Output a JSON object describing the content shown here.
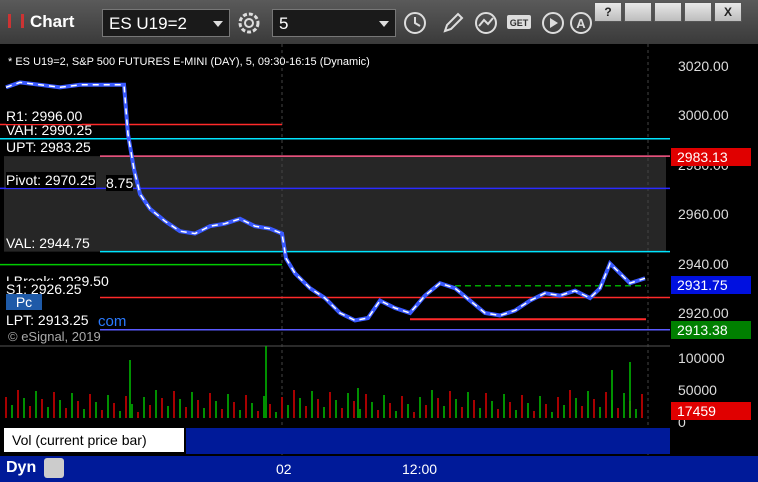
{
  "toolbar": {
    "title": "Chart",
    "symbol": "ES U19=2",
    "interval": "5",
    "icons": [
      "settings-icon",
      "clock-icon",
      "pencil-icon",
      "study-icon",
      "get-icon",
      "play-icon",
      "text-a-icon"
    ],
    "window_buttons": [
      "?",
      "",
      "",
      "X"
    ]
  },
  "chart": {
    "study_label": "* ES U19=2, S&P 500 FUTURES E-MINI (DAY), 5, 09:30-16:15 (Dynamic)",
    "levels": [
      {
        "label": "R1: 2996.00",
        "value": 2996.0,
        "color": "#ff2a2a"
      },
      {
        "label": "VAH: 2990.25",
        "value": 2990.25,
        "color": "#00e5ff"
      },
      {
        "label": "UPT: 2983.25",
        "value": 2983.25,
        "color": "#ff5a8a"
      },
      {
        "label": "Pivot: 2970.25",
        "value": 2970.25,
        "color": "#2a2aff"
      },
      {
        "label": "VAL: 2944.75",
        "value": 2944.75,
        "color": "#00e5ff"
      },
      {
        "label": "LBreak: 2939.50",
        "value": 2939.5,
        "color": "#00cc00"
      },
      {
        "label": "S1: 2926.25",
        "value": 2926.25,
        "color": "#ff2a2a"
      },
      {
        "label": "LPT: 2913.25",
        "value": 2913.25,
        "color": "#5a5aff"
      }
    ],
    "extra_label": "8.75",
    "pc_label": "Pc",
    "com_label": "com",
    "copyright": "© eSignal, 2019"
  },
  "axis": {
    "price_ticks": [
      "3020.00",
      "3000.00",
      "2980.00",
      "2960.00",
      "2940.00",
      "2920.00"
    ],
    "volume_ticks": [
      "100000",
      "50000",
      "0"
    ],
    "time_ticks": [
      "02",
      "12:00"
    ],
    "price_tags": [
      {
        "label": "2983.13",
        "color": "#e00000"
      },
      {
        "label": "2931.75",
        "color": "#0010e0"
      },
      {
        "label": "2913.38",
        "color": "#008000"
      },
      {
        "label": "17459",
        "color": "#e00000"
      }
    ]
  },
  "volume_panel": {
    "label": "Vol (current price bar)",
    "close": "x"
  },
  "status": {
    "mode": "Dyn"
  }
}
